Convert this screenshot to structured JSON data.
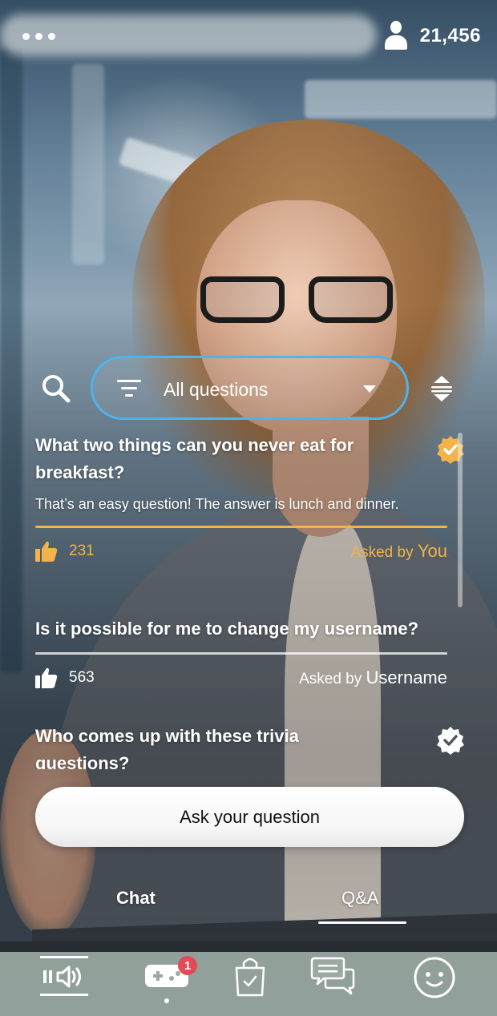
{
  "header": {
    "more_icon": "more-horizontal-icon",
    "viewer_icon": "user-icon",
    "viewer_count": "21,456"
  },
  "filter": {
    "search_icon": "search-icon",
    "filter_icon": "filter-lines-icon",
    "selected": "All questions",
    "caret_icon": "chevron-down-icon",
    "sort_icon": "sort-icon",
    "accent_color": "#4db4ef"
  },
  "questions": [
    {
      "title": "What two things can you never eat for breakfast?",
      "answer": "That’s an easy question! The answer is lunch and dinner.",
      "likes": "231",
      "asked_by_prefix": "Asked by",
      "asked_by_name": "You",
      "answered": true,
      "highlight_color": "#f3b34a"
    },
    {
      "title": "Is it possible for me to change my username?",
      "answer": "",
      "likes": "563",
      "asked_by_prefix": "Asked by",
      "asked_by_name": "Username",
      "answered": false
    },
    {
      "title": "Who comes up with these trivia questions?",
      "answered": true
    }
  ],
  "ask_button": "Ask your question",
  "tabs": [
    {
      "label": "Chat",
      "active": false
    },
    {
      "label": "Q&A",
      "active": true
    }
  ],
  "bottom_nav": {
    "items": [
      {
        "icon": "pause-volume-icon"
      },
      {
        "icon": "gamepad-icon",
        "badge": "1"
      },
      {
        "icon": "shopping-bag-icon"
      },
      {
        "icon": "chat-bubbles-icon"
      },
      {
        "icon": "smiley-icon"
      }
    ]
  }
}
